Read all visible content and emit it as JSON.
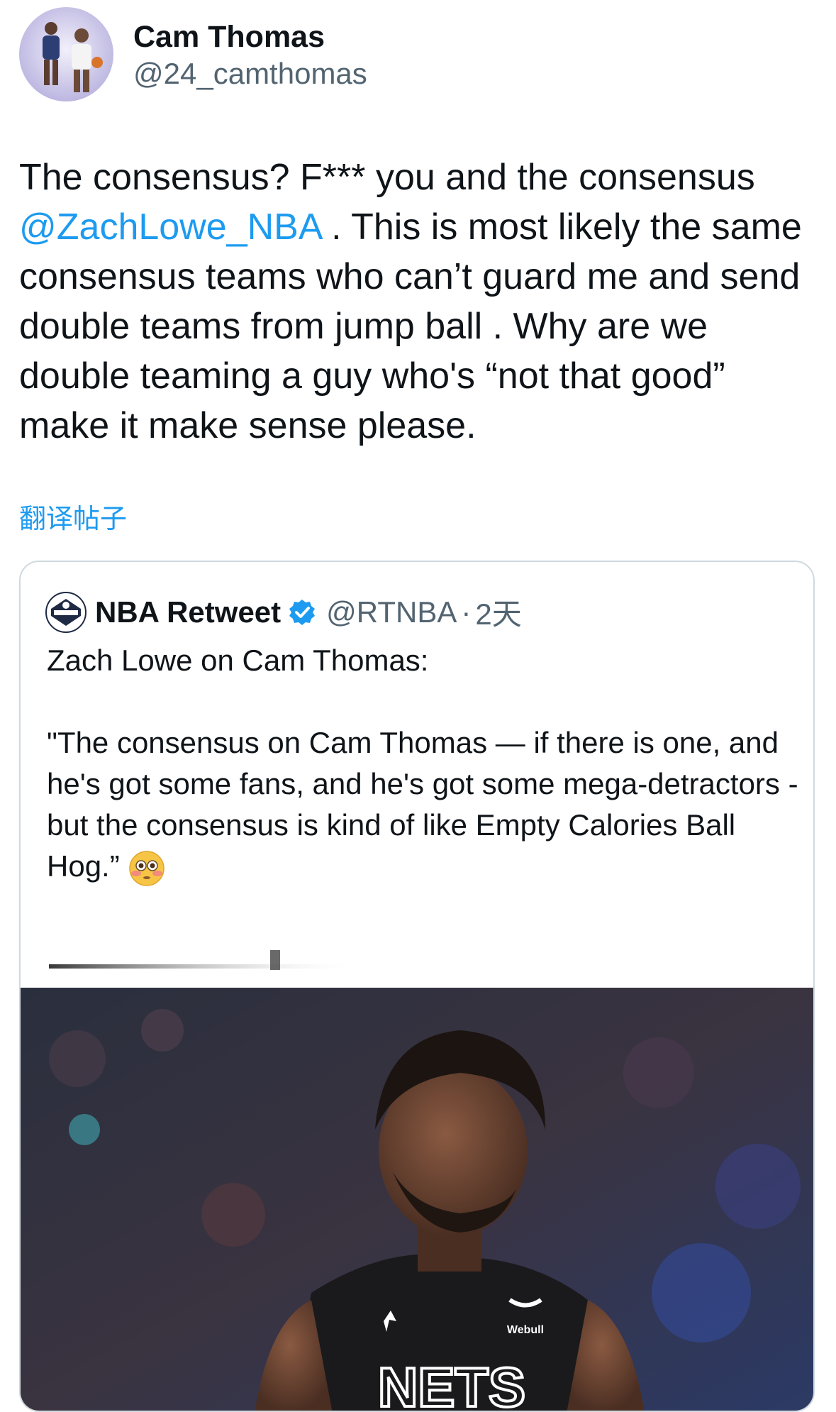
{
  "author": {
    "display_name": "Cam Thomas",
    "handle": "@24_camthomas"
  },
  "tweet": {
    "text_part1": "The consensus? F*** you and the consensus\n",
    "mention": "@ZachLowe_NBA",
    "text_part2": " . This is most likely the same consensus teams who can’t guard me and send double teams from jump ball . Why are we double teaming a guy who's “not that good” make it make sense please.",
    "translate_label": "翻译帖子"
  },
  "quote": {
    "display_name": "NBA Retweet",
    "verified": true,
    "handle": "@RTNBA",
    "separator": "·",
    "time": "2天",
    "line1": "Zach Lowe on Cam Thomas:",
    "line2": "\"The consensus on Cam Thomas — if there is one, and he's got some fans, and he's got some mega-detractors - but the consensus is kind of like Empty Calories Ball Hog.”",
    "emoji": "flushed-face-emoji",
    "jersey_text": "NETS",
    "sponsor_text": "Webull"
  },
  "colors": {
    "link": "#1d9bf0",
    "secondary_text": "#536471",
    "border": "#cfd9de",
    "verified_badge": "#1d9bf0"
  }
}
